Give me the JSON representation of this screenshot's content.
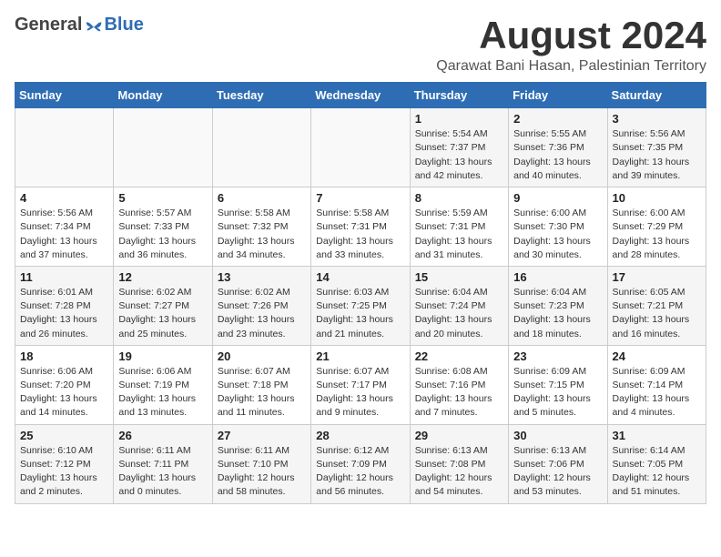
{
  "header": {
    "logo_general": "General",
    "logo_blue": "Blue",
    "month_title": "August 2024",
    "location": "Qarawat Bani Hasan, Palestinian Territory"
  },
  "weekdays": [
    "Sunday",
    "Monday",
    "Tuesday",
    "Wednesday",
    "Thursday",
    "Friday",
    "Saturday"
  ],
  "weeks": [
    [
      {
        "day": "",
        "info": ""
      },
      {
        "day": "",
        "info": ""
      },
      {
        "day": "",
        "info": ""
      },
      {
        "day": "",
        "info": ""
      },
      {
        "day": "1",
        "info": "Sunrise: 5:54 AM\nSunset: 7:37 PM\nDaylight: 13 hours\nand 42 minutes."
      },
      {
        "day": "2",
        "info": "Sunrise: 5:55 AM\nSunset: 7:36 PM\nDaylight: 13 hours\nand 40 minutes."
      },
      {
        "day": "3",
        "info": "Sunrise: 5:56 AM\nSunset: 7:35 PM\nDaylight: 13 hours\nand 39 minutes."
      }
    ],
    [
      {
        "day": "4",
        "info": "Sunrise: 5:56 AM\nSunset: 7:34 PM\nDaylight: 13 hours\nand 37 minutes."
      },
      {
        "day": "5",
        "info": "Sunrise: 5:57 AM\nSunset: 7:33 PM\nDaylight: 13 hours\nand 36 minutes."
      },
      {
        "day": "6",
        "info": "Sunrise: 5:58 AM\nSunset: 7:32 PM\nDaylight: 13 hours\nand 34 minutes."
      },
      {
        "day": "7",
        "info": "Sunrise: 5:58 AM\nSunset: 7:31 PM\nDaylight: 13 hours\nand 33 minutes."
      },
      {
        "day": "8",
        "info": "Sunrise: 5:59 AM\nSunset: 7:31 PM\nDaylight: 13 hours\nand 31 minutes."
      },
      {
        "day": "9",
        "info": "Sunrise: 6:00 AM\nSunset: 7:30 PM\nDaylight: 13 hours\nand 30 minutes."
      },
      {
        "day": "10",
        "info": "Sunrise: 6:00 AM\nSunset: 7:29 PM\nDaylight: 13 hours\nand 28 minutes."
      }
    ],
    [
      {
        "day": "11",
        "info": "Sunrise: 6:01 AM\nSunset: 7:28 PM\nDaylight: 13 hours\nand 26 minutes."
      },
      {
        "day": "12",
        "info": "Sunrise: 6:02 AM\nSunset: 7:27 PM\nDaylight: 13 hours\nand 25 minutes."
      },
      {
        "day": "13",
        "info": "Sunrise: 6:02 AM\nSunset: 7:26 PM\nDaylight: 13 hours\nand 23 minutes."
      },
      {
        "day": "14",
        "info": "Sunrise: 6:03 AM\nSunset: 7:25 PM\nDaylight: 13 hours\nand 21 minutes."
      },
      {
        "day": "15",
        "info": "Sunrise: 6:04 AM\nSunset: 7:24 PM\nDaylight: 13 hours\nand 20 minutes."
      },
      {
        "day": "16",
        "info": "Sunrise: 6:04 AM\nSunset: 7:23 PM\nDaylight: 13 hours\nand 18 minutes."
      },
      {
        "day": "17",
        "info": "Sunrise: 6:05 AM\nSunset: 7:21 PM\nDaylight: 13 hours\nand 16 minutes."
      }
    ],
    [
      {
        "day": "18",
        "info": "Sunrise: 6:06 AM\nSunset: 7:20 PM\nDaylight: 13 hours\nand 14 minutes."
      },
      {
        "day": "19",
        "info": "Sunrise: 6:06 AM\nSunset: 7:19 PM\nDaylight: 13 hours\nand 13 minutes."
      },
      {
        "day": "20",
        "info": "Sunrise: 6:07 AM\nSunset: 7:18 PM\nDaylight: 13 hours\nand 11 minutes."
      },
      {
        "day": "21",
        "info": "Sunrise: 6:07 AM\nSunset: 7:17 PM\nDaylight: 13 hours\nand 9 minutes."
      },
      {
        "day": "22",
        "info": "Sunrise: 6:08 AM\nSunset: 7:16 PM\nDaylight: 13 hours\nand 7 minutes."
      },
      {
        "day": "23",
        "info": "Sunrise: 6:09 AM\nSunset: 7:15 PM\nDaylight: 13 hours\nand 5 minutes."
      },
      {
        "day": "24",
        "info": "Sunrise: 6:09 AM\nSunset: 7:14 PM\nDaylight: 13 hours\nand 4 minutes."
      }
    ],
    [
      {
        "day": "25",
        "info": "Sunrise: 6:10 AM\nSunset: 7:12 PM\nDaylight: 13 hours\nand 2 minutes."
      },
      {
        "day": "26",
        "info": "Sunrise: 6:11 AM\nSunset: 7:11 PM\nDaylight: 13 hours\nand 0 minutes."
      },
      {
        "day": "27",
        "info": "Sunrise: 6:11 AM\nSunset: 7:10 PM\nDaylight: 12 hours\nand 58 minutes."
      },
      {
        "day": "28",
        "info": "Sunrise: 6:12 AM\nSunset: 7:09 PM\nDaylight: 12 hours\nand 56 minutes."
      },
      {
        "day": "29",
        "info": "Sunrise: 6:13 AM\nSunset: 7:08 PM\nDaylight: 12 hours\nand 54 minutes."
      },
      {
        "day": "30",
        "info": "Sunrise: 6:13 AM\nSunset: 7:06 PM\nDaylight: 12 hours\nand 53 minutes."
      },
      {
        "day": "31",
        "info": "Sunrise: 6:14 AM\nSunset: 7:05 PM\nDaylight: 12 hours\nand 51 minutes."
      }
    ]
  ]
}
